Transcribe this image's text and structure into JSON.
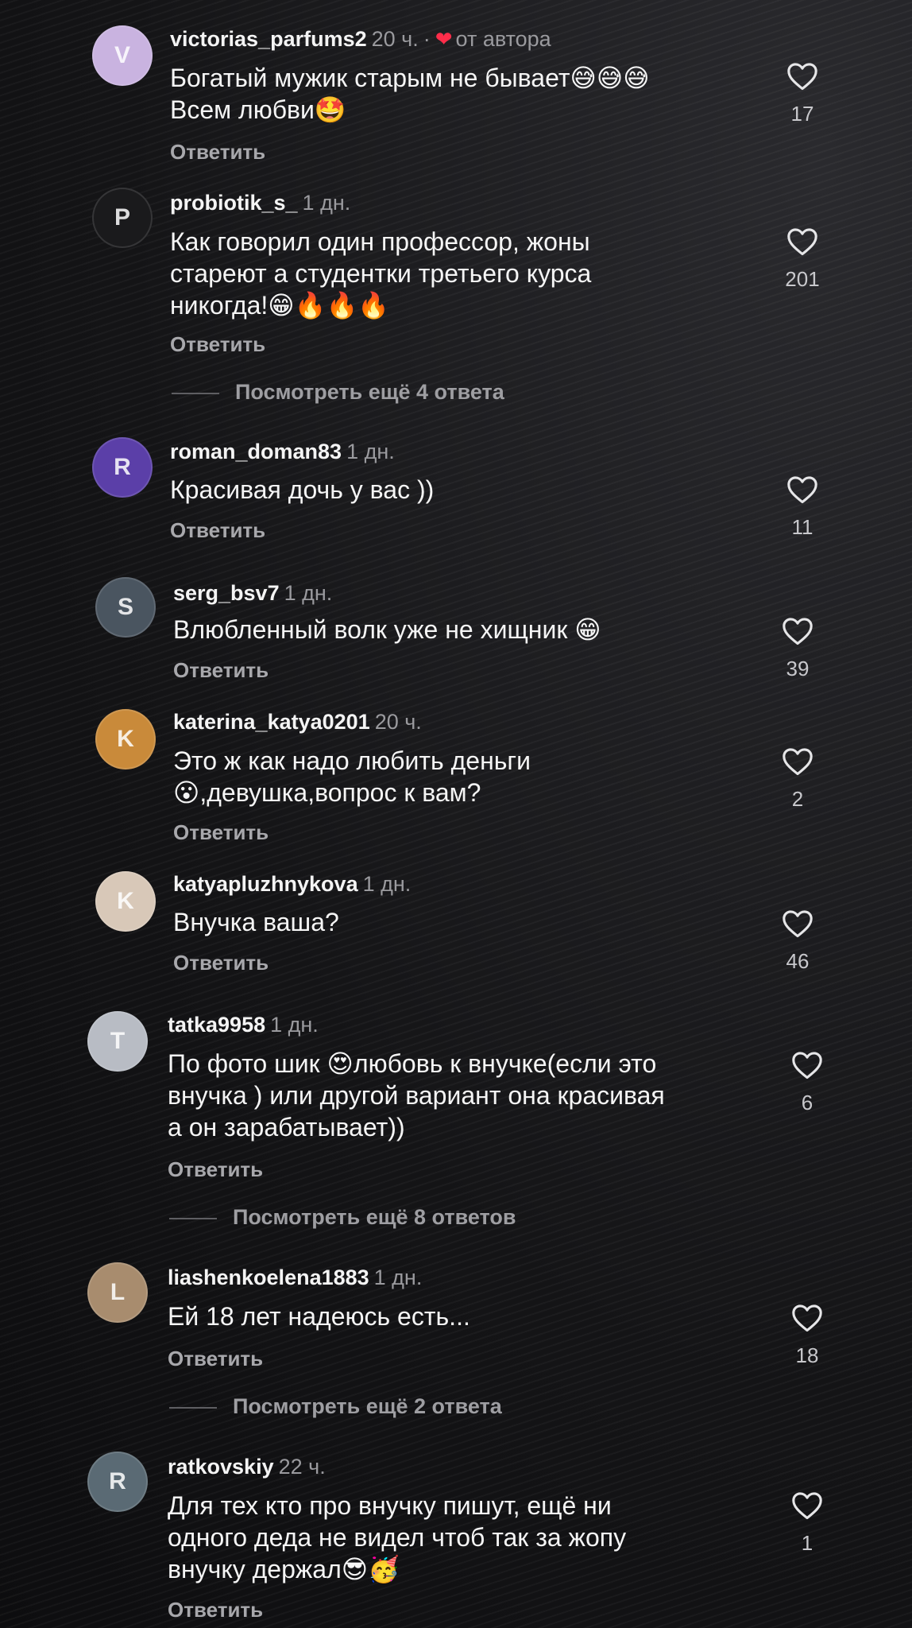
{
  "comments": [
    {
      "username": "victorias_parfums2",
      "time": "20 ч.",
      "author_label": "от автора",
      "text": "Богатый мужик старым не бывает😅😅😅\nВсем любви🤩",
      "reply_label": "Ответить",
      "likes": "17",
      "avatar_color": "#c9b3e0",
      "avatar_initial": "V"
    },
    {
      "username": "probiotik_s_",
      "time": "1 дн.",
      "text": "Как говорил один профессор, жоны\nстареют а студентки третьего курса\nникогда!😁🔥🔥🔥",
      "reply_label": "Ответить",
      "likes": "201",
      "avatar_color": "#1a1a1c",
      "avatar_initial": "P"
    },
    {
      "username": "roman_doman83",
      "time": "1 дн.",
      "text": "Красивая дочь у вас ))",
      "reply_label": "Ответить",
      "likes": "11",
      "avatar_color": "#5b3fa8",
      "avatar_initial": "R"
    },
    {
      "username": "serg_bsv7",
      "time": "1 дн.",
      "text": "Влюбленный волк уже не хищник 😁",
      "reply_label": "Ответить",
      "likes": "39",
      "avatar_color": "#4a5560",
      "avatar_initial": "S"
    },
    {
      "username": "katerina_katya0201",
      "time": "20 ч.",
      "text": "Это ж как надо любить деньги\n😮,девушка,вопрос к вам?",
      "reply_label": "Ответить",
      "likes": "2",
      "avatar_color": "#c98a3a",
      "avatar_initial": "K"
    },
    {
      "username": "katyapluzhnykova",
      "time": "1 дн.",
      "text": "Внучка ваша?",
      "reply_label": "Ответить",
      "likes": "46",
      "avatar_color": "#d8c8b8",
      "avatar_initial": "K"
    },
    {
      "username": "tatka9958",
      "time": "1 дн.",
      "text": "По фото шик 😍любовь к внучке(если это\nвнучка )  или другой вариант она красивая\nа он зарабатывает))",
      "reply_label": "Ответить",
      "likes": "6",
      "avatar_color": "#b8bcc4",
      "avatar_initial": "T"
    },
    {
      "username": "liashenkoelena1883",
      "time": "1 дн.",
      "text": "Ей 18 лет надеюсь есть...",
      "reply_label": "Ответить",
      "likes": "18",
      "avatar_color": "#a88c6e",
      "avatar_initial": "L"
    },
    {
      "username": "ratkovskiy",
      "time": "22 ч.",
      "text": "Для тех кто про внучку пишут, ещё ни\nодного деда не видел чтоб так за жопу\nвнучку держал😎🥳",
      "reply_label": "Ответить",
      "likes": "1",
      "avatar_color": "#5a6a74",
      "avatar_initial": "R"
    }
  ],
  "view_more": [
    "Посмотреть ещё 4 ответа",
    "Посмотреть ещё 8 ответов",
    "Посмотреть ещё 2 ответа"
  ],
  "icons": {
    "like": "heart-outline-icon",
    "author_like": "heart-filled-icon"
  },
  "colors": {
    "author_heart": "#ff2d4a",
    "secondary_text": "#9a9a9e"
  }
}
